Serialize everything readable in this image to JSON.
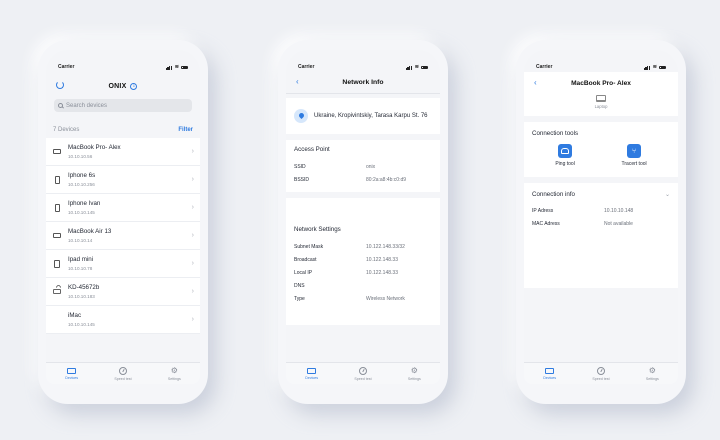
{
  "colors": {
    "accent": "#2f7be0",
    "background": "#eef0f4"
  },
  "phone1": {
    "carrier": "Carrier",
    "title": "ONIX",
    "search_placeholder": "Search devices",
    "count_label": "7 Devices",
    "filter_label": "Filter",
    "devices": [
      {
        "name": "MacBook Pro- Alex",
        "ip": "10.10.10.56",
        "icon": "laptop-icon"
      },
      {
        "name": "Iphone 6s",
        "ip": "10.10.10.256",
        "icon": "phone-icon"
      },
      {
        "name": "Iphone Ivan",
        "ip": "10.10.10.145",
        "icon": "phone-icon"
      },
      {
        "name": "MacBook Air 13",
        "ip": "10.10.10.14",
        "icon": "laptop-icon"
      },
      {
        "name": "Ipad mini",
        "ip": "10.10.10.78",
        "icon": "tablet-icon"
      },
      {
        "name": "KD-45672b",
        "ip": "10.10.10.183",
        "icon": "router-icon"
      },
      {
        "name": "iMac",
        "ip": "10.10.10.145",
        "icon": "none"
      }
    ],
    "tabs": {
      "devices": "Devices",
      "speed": "Speed test",
      "settings": "Settings"
    }
  },
  "phone2": {
    "carrier": "Carrier",
    "title": "Network Info",
    "location": "Ukraine, Kropivintskiy, Tarasa Karpu St. 76",
    "access_point": {
      "title": "Access Point",
      "rows": [
        {
          "k": "SSID",
          "v": "onix"
        },
        {
          "k": "BSSID",
          "v": "80:2a:a8:4b:c0:d9"
        }
      ]
    },
    "network_settings": {
      "title": "Network Settings",
      "rows": [
        {
          "k": "Subnet Mask",
          "v": "10.122.148.33/32"
        },
        {
          "k": "Broadcast",
          "v": "10.122.148.33"
        },
        {
          "k": "Local IP",
          "v": "10.122.148.33"
        },
        {
          "k": "DNS",
          "v": ""
        },
        {
          "k": "Type",
          "v": "Wireless Network"
        }
      ]
    },
    "tabs": {
      "devices": "Devices",
      "speed": "Speed test",
      "settings": "Settings"
    }
  },
  "phone3": {
    "carrier": "Carrier",
    "title": "MacBook Pro- Alex",
    "device_type": "Laptop",
    "tools": {
      "title": "Connection tools",
      "ping": "Ping tool",
      "tracert": "Tracert tool"
    },
    "info": {
      "title": "Connection info",
      "rows": [
        {
          "k": "IP Adress",
          "v": "10.10.10.148"
        },
        {
          "k": "MAC Adress",
          "v": "Not available"
        }
      ]
    },
    "tabs": {
      "devices": "Devices",
      "speed": "Speed test",
      "settings": "Settings"
    }
  }
}
